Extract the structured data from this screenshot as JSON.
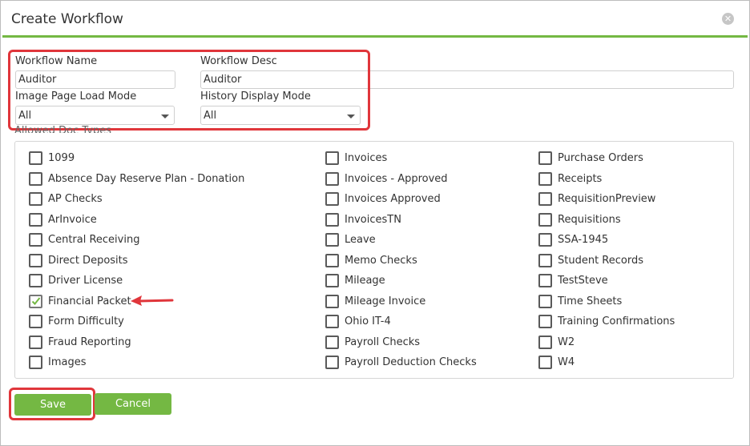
{
  "dialog": {
    "title": "Create Workflow",
    "close_glyph": "✕"
  },
  "form": {
    "workflow_name_label": "Workflow Name",
    "workflow_name_value": "Auditor",
    "workflow_desc_label": "Workflow Desc",
    "workflow_desc_value": "Auditor",
    "image_load_label": "Image Page Load Mode",
    "image_load_value": "All",
    "history_label": "History Display Mode",
    "history_value": "All"
  },
  "doc_types": {
    "label": "Allowed Doc Types",
    "columns": [
      [
        {
          "label": "1099",
          "checked": false
        },
        {
          "label": "Absence Day Reserve Plan - Donation",
          "checked": false
        },
        {
          "label": "AP Checks",
          "checked": false
        },
        {
          "label": "ArInvoice",
          "checked": false
        },
        {
          "label": "Central Receiving",
          "checked": false
        },
        {
          "label": "Direct Deposits",
          "checked": false
        },
        {
          "label": "Driver License",
          "checked": false
        },
        {
          "label": "Financial Packet",
          "checked": true
        },
        {
          "label": "Form Difficulty",
          "checked": false
        },
        {
          "label": "Fraud Reporting",
          "checked": false
        },
        {
          "label": "Images",
          "checked": false
        }
      ],
      [
        {
          "label": "Invoices",
          "checked": false
        },
        {
          "label": "Invoices - Approved",
          "checked": false
        },
        {
          "label": "Invoices Approved",
          "checked": false
        },
        {
          "label": "InvoicesTN",
          "checked": false
        },
        {
          "label": "Leave",
          "checked": false
        },
        {
          "label": "Memo Checks",
          "checked": false
        },
        {
          "label": "Mileage",
          "checked": false
        },
        {
          "label": "Mileage Invoice",
          "checked": false
        },
        {
          "label": "Ohio IT-4",
          "checked": false
        },
        {
          "label": "Payroll Checks",
          "checked": false
        },
        {
          "label": "Payroll Deduction Checks",
          "checked": false
        }
      ],
      [
        {
          "label": "Purchase Orders",
          "checked": false
        },
        {
          "label": "Receipts",
          "checked": false
        },
        {
          "label": "RequisitionPreview",
          "checked": false
        },
        {
          "label": "Requisitions",
          "checked": false
        },
        {
          "label": "SSA-1945",
          "checked": false
        },
        {
          "label": "Student Records",
          "checked": false
        },
        {
          "label": "TestSteve",
          "checked": false
        },
        {
          "label": "Time Sheets",
          "checked": false
        },
        {
          "label": "Training Confirmations",
          "checked": false
        },
        {
          "label": "W2",
          "checked": false
        },
        {
          "label": "W4",
          "checked": false
        }
      ]
    ]
  },
  "buttons": {
    "save_label": "Save",
    "cancel_label": "Cancel"
  },
  "colors": {
    "accent_green": "#74b843",
    "highlight_red": "#e0363b"
  }
}
